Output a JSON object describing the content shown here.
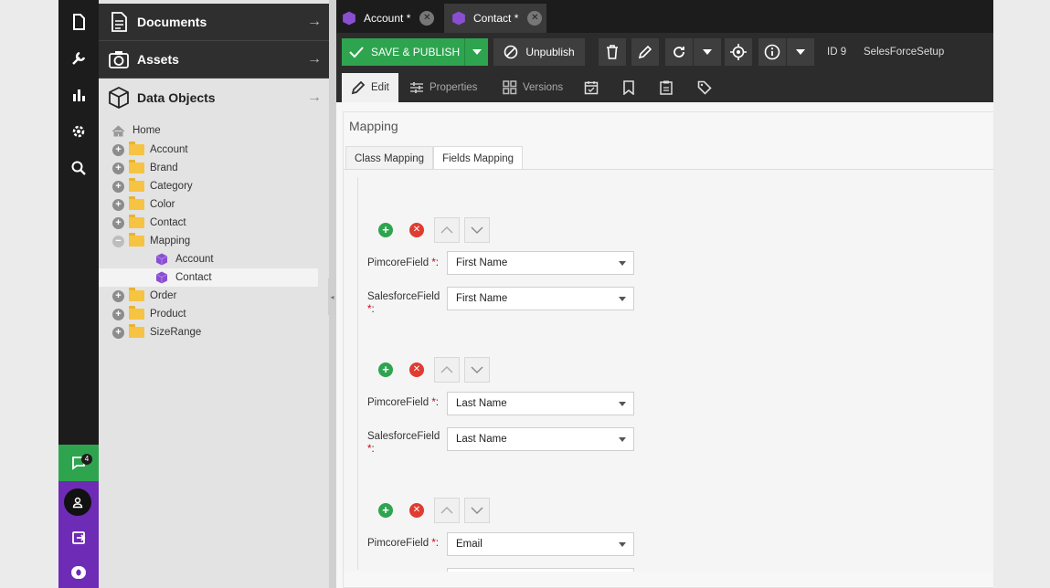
{
  "rail": {
    "icons": [
      "document-icon",
      "wrench-icon",
      "chart-icon",
      "gear-icon",
      "search-icon"
    ],
    "notification_count": "4",
    "colors": {
      "green": "#2ea44f",
      "purple": "#6e2bb5"
    }
  },
  "panel": {
    "sections": [
      {
        "label": "Documents",
        "icon": "document-icon"
      },
      {
        "label": "Assets",
        "icon": "camera-icon"
      },
      {
        "label": "Data Objects",
        "icon": "cube-icon"
      }
    ],
    "tree": [
      {
        "label": "Home",
        "type": "home"
      },
      {
        "label": "Account",
        "type": "folder"
      },
      {
        "label": "Brand",
        "type": "folder"
      },
      {
        "label": "Category",
        "type": "folder"
      },
      {
        "label": "Color",
        "type": "folder"
      },
      {
        "label": "Contact",
        "type": "folder"
      },
      {
        "label": "Mapping",
        "type": "folder-open"
      },
      {
        "label": "Account",
        "type": "object"
      },
      {
        "label": "Contact",
        "type": "object"
      },
      {
        "label": "Order",
        "type": "folder"
      },
      {
        "label": "Product",
        "type": "folder"
      },
      {
        "label": "SizeRange",
        "type": "folder"
      }
    ]
  },
  "tabs": [
    {
      "label": "Account *"
    },
    {
      "label": "Contact *"
    }
  ],
  "toolbar": {
    "save_label": "SAVE & PUBLISH",
    "unpublish_label": "Unpublish",
    "id_label": "ID 9",
    "object_name": "SelesForceSetup"
  },
  "subtabs": {
    "edit": "Edit",
    "properties": "Properties",
    "versions": "Versions"
  },
  "content": {
    "title": "Mapping",
    "inner_tabs": [
      "Class Mapping",
      "Fields Mapping"
    ],
    "pimcore_label": "PimcoreField",
    "salesforce_label": "SalesforceField",
    "req_marker": "*",
    "colon": ":",
    "rows": [
      {
        "pimcore": "First Name",
        "salesforce": "First Name"
      },
      {
        "pimcore": "Last Name",
        "salesforce": "Last Name"
      },
      {
        "pimcore": "Email",
        "salesforce": ""
      }
    ]
  }
}
